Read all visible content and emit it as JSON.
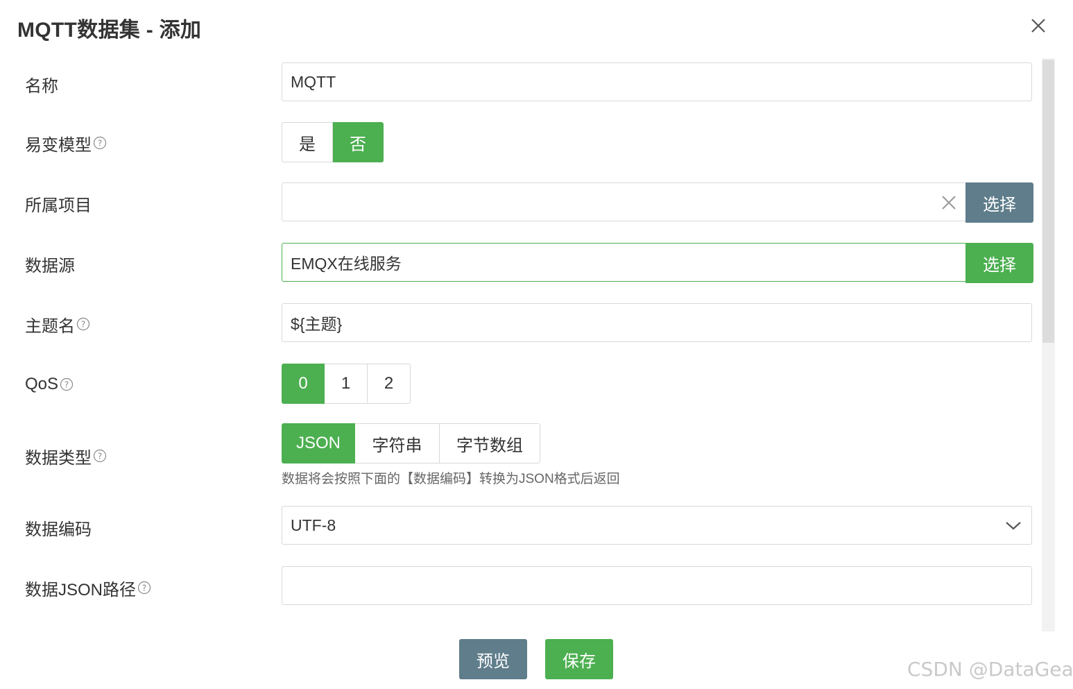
{
  "dialog": {
    "title": "MQTT数据集 - 添加",
    "close_icon": "close-icon"
  },
  "form": {
    "name": {
      "label": "名称",
      "value": "MQTT"
    },
    "volatile_model": {
      "label": "易变模型",
      "options": [
        "是",
        "否"
      ],
      "selected": "否"
    },
    "project": {
      "label": "所属项目",
      "value": "",
      "select_label": "选择"
    },
    "data_source": {
      "label": "数据源",
      "value": "EMQX在线服务",
      "select_label": "选择"
    },
    "topic": {
      "label": "主题名",
      "value": "${主题}"
    },
    "qos": {
      "label": "QoS",
      "options": [
        "0",
        "1",
        "2"
      ],
      "selected": "0"
    },
    "data_type": {
      "label": "数据类型",
      "options": [
        "JSON",
        "字符串",
        "字节数组"
      ],
      "selected": "JSON",
      "hint": "数据将会按照下面的【数据编码】转换为JSON格式后返回"
    },
    "encoding": {
      "label": "数据编码",
      "value": "UTF-8"
    },
    "json_path": {
      "label": "数据JSON路径",
      "value": ""
    }
  },
  "footer": {
    "preview_label": "预览",
    "save_label": "保存"
  },
  "watermark": "CSDN @DataGear",
  "colors": {
    "accent_green": "#4caf50",
    "slate_gray": "#5f7d8b",
    "border": "#d8d8d8"
  }
}
